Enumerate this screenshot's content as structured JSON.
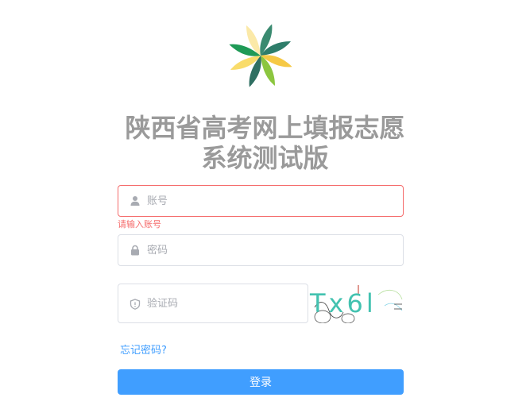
{
  "header": {
    "title_line1": "陕西省高考网上填报志愿",
    "title_line2": "系统测试版"
  },
  "form": {
    "account": {
      "placeholder": "账号",
      "value": "",
      "icon": "user-icon",
      "error": "请输入账号"
    },
    "password": {
      "placeholder": "密码",
      "value": "",
      "icon": "lock-icon"
    },
    "captcha": {
      "placeholder": "验证码",
      "value": "",
      "icon": "shield-icon",
      "image_text": "Tx6l"
    },
    "forgot_label": "忘记密码?",
    "submit_label": "登录"
  },
  "colors": {
    "primary": "#409eff",
    "error": "#f56c6c",
    "title": "#9a9a9a",
    "border": "#dcdfe6"
  }
}
